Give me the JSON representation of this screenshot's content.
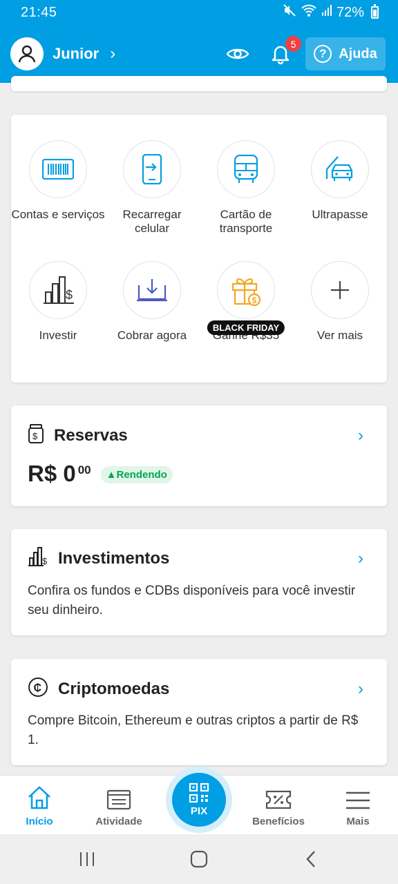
{
  "status": {
    "time": "21:45",
    "battery": "72%"
  },
  "header": {
    "username": "Junior",
    "notifications": "5",
    "help_label": "Ajuda"
  },
  "shortcuts": [
    {
      "label": "Contas e serviços",
      "icon": "barcode-icon"
    },
    {
      "label": "Recarregar celular",
      "icon": "phone-recharge-icon"
    },
    {
      "label": "Cartão de transporte",
      "icon": "bus-icon"
    },
    {
      "label": "Ultrapasse",
      "icon": "car-toll-icon"
    },
    {
      "label": "Investir",
      "icon": "invest-chart-icon"
    },
    {
      "label": "Cobrar agora",
      "icon": "receive-payment-icon"
    },
    {
      "label": "Ganhe R$35",
      "icon": "gift-icon",
      "tag": "BLACK FRIDAY"
    },
    {
      "label": "Ver mais",
      "icon": "plus-icon"
    }
  ],
  "reservas": {
    "title": "Reservas",
    "amount": "R$ 0",
    "cents": "00",
    "status": "Rendendo"
  },
  "investimentos": {
    "title": "Investimentos",
    "text": "Confira os fundos e CDBs disponíveis para você investir seu dinheiro."
  },
  "cripto": {
    "title": "Criptomoedas",
    "text": "Compre Bitcoin, Ethereum e outras criptos a partir de R$ 1."
  },
  "nav": {
    "home": "Início",
    "activity": "Atividade",
    "pix": "PIX",
    "benefits": "Benefícios",
    "more": "Mais"
  },
  "colors": {
    "brand": "#009ee3",
    "badge": "#ef4140",
    "positive": "#00a650",
    "gift": "#f5a623"
  }
}
